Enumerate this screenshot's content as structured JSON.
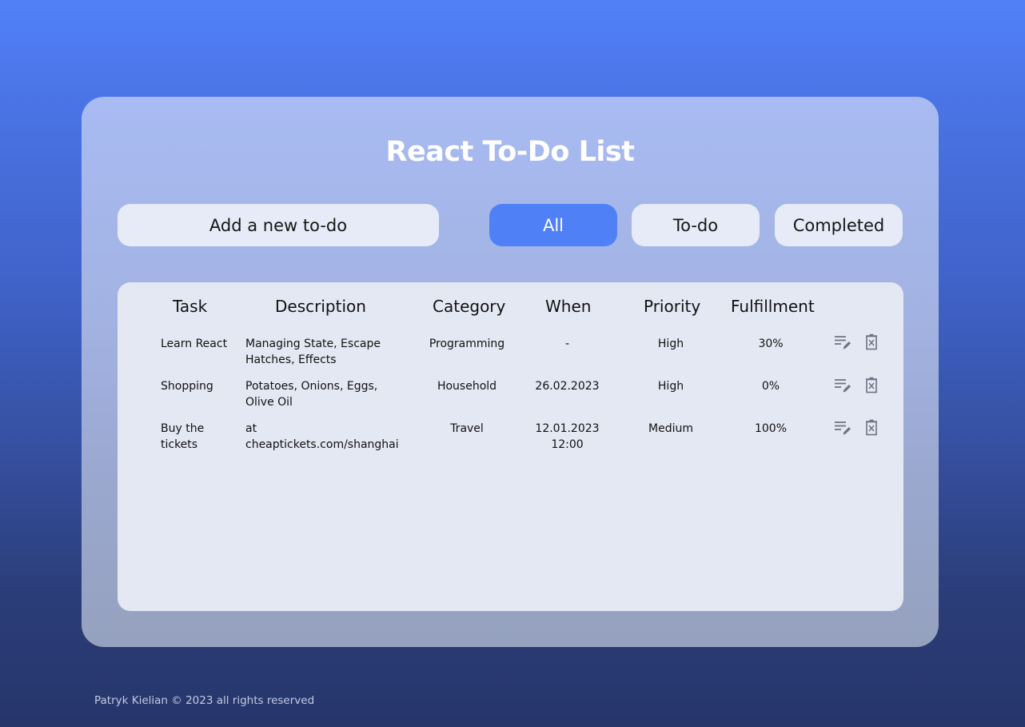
{
  "app": {
    "title": "React To-Do List"
  },
  "toolbar": {
    "add_label": "Add a new to-do",
    "filters": [
      {
        "label": "All",
        "active": true
      },
      {
        "label": "To-do",
        "active": false
      },
      {
        "label": "Completed",
        "active": false
      }
    ]
  },
  "table": {
    "headers": [
      "Task",
      "Description",
      "Category",
      "When",
      "Priority",
      "Fulfillment"
    ],
    "rows": [
      {
        "task": "Learn React",
        "description": "Managing State, Escape Hatches, Effects",
        "category": "Programming",
        "when": "-",
        "priority": "High",
        "fulfillment": "30%"
      },
      {
        "task": "Shopping",
        "description": "Potatoes, Onions, Eggs, Olive Oil",
        "category": "Household",
        "when": "26.02.2023",
        "priority": "High",
        "fulfillment": "0%"
      },
      {
        "task": "Buy the tickets",
        "description": "at cheaptickets.com/shanghai",
        "category": "Travel",
        "when": "12.01.2023 12:00",
        "priority": "Medium",
        "fulfillment": "100%"
      }
    ],
    "row_icons": [
      "edit-icon",
      "delete-icon"
    ]
  },
  "footer": {
    "text": "Patryk Kielian © 2023 all rights reserved"
  },
  "colors": {
    "accent": "#5080f6",
    "pill_bg": "#e6ebf7",
    "panel_bg": "#e4e8f2",
    "icon": "#6e7385"
  }
}
